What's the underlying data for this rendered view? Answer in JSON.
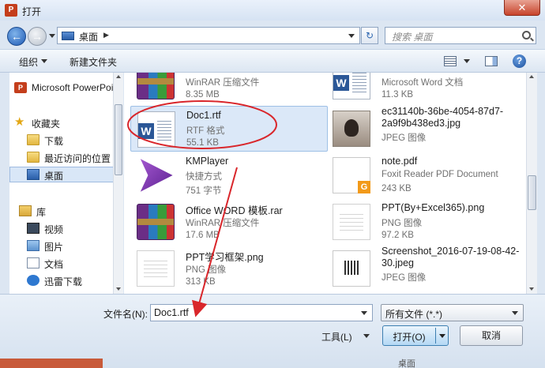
{
  "window": {
    "title": "打开",
    "app_logo": "P",
    "close_label": "✕"
  },
  "address": {
    "location": "桌面",
    "search_placeholder": "搜索 桌面"
  },
  "toolbar": {
    "organize_label": "组织",
    "new_folder_label": "新建文件夹"
  },
  "sidebar": {
    "items": [
      {
        "label": "Microsoft PowerPoint",
        "icon": "powerpoint-icon"
      },
      {
        "label": "收藏夹",
        "icon": "star-icon"
      },
      {
        "label": "下载",
        "icon": "folder-icon"
      },
      {
        "label": "最近访问的位置",
        "icon": "folder-icon"
      },
      {
        "label": "桌面",
        "icon": "desktop-icon",
        "selected": true
      },
      {
        "label": "库",
        "icon": "library-icon"
      },
      {
        "label": "视频",
        "icon": "video-icon"
      },
      {
        "label": "图片",
        "icon": "picture-icon"
      },
      {
        "label": "文档",
        "icon": "document-icon"
      },
      {
        "label": "迅雷下载",
        "icon": "xunlei-icon"
      }
    ]
  },
  "files": [
    {
      "name": "",
      "type": "WinRAR 压缩文件",
      "size": "8.35 MB",
      "icon": "winrar-icon"
    },
    {
      "name": "",
      "type": "Microsoft Word 文档",
      "size": "11.3 KB",
      "icon": "word-icon"
    },
    {
      "name": "Doc1.rtf",
      "type": "RTF 格式",
      "size": "55.1 KB",
      "icon": "word-icon",
      "selected": true
    },
    {
      "name": "ec31140b-36be-4054-87d7-2a9f9b438ed3.jpg",
      "type": "JPEG 图像",
      "size": "",
      "icon": "photo-icon"
    },
    {
      "name": "KMPlayer",
      "type": "快捷方式",
      "size": "751 字节",
      "icon": "kmplayer-icon"
    },
    {
      "name": "note.pdf",
      "type": "Foxit Reader PDF Document",
      "size": "243 KB",
      "icon": "pdf-icon"
    },
    {
      "name": "Office WORD 模板.rar",
      "type": "WinRAR 压缩文件",
      "size": "17.6 MB",
      "icon": "winrar-icon"
    },
    {
      "name": "PPT(By+Excel365).png",
      "type": "PNG 图像",
      "size": "97.2 KB",
      "icon": "png-icon"
    },
    {
      "name": "PPT学习框架.png",
      "type": "PNG 图像",
      "size": "313 KB",
      "icon": "png-icon"
    },
    {
      "name": "Screenshot_2016-07-19-08-42-30.jpeg",
      "type": "JPEG 图像",
      "size": "",
      "icon": "screenshot-icon"
    }
  ],
  "footer": {
    "filename_label": "文件名(N):",
    "filename_value": "Doc1.rtf",
    "filter_value": "所有文件 (*.*)",
    "tools_label": "工具(L)",
    "open_label": "打开(O)",
    "cancel_label": "取消",
    "background_text": "桌面"
  },
  "colors": {
    "annotation": "#d9262b",
    "selection": "#dbe8f8",
    "titlebar": "#d6e3f3"
  }
}
